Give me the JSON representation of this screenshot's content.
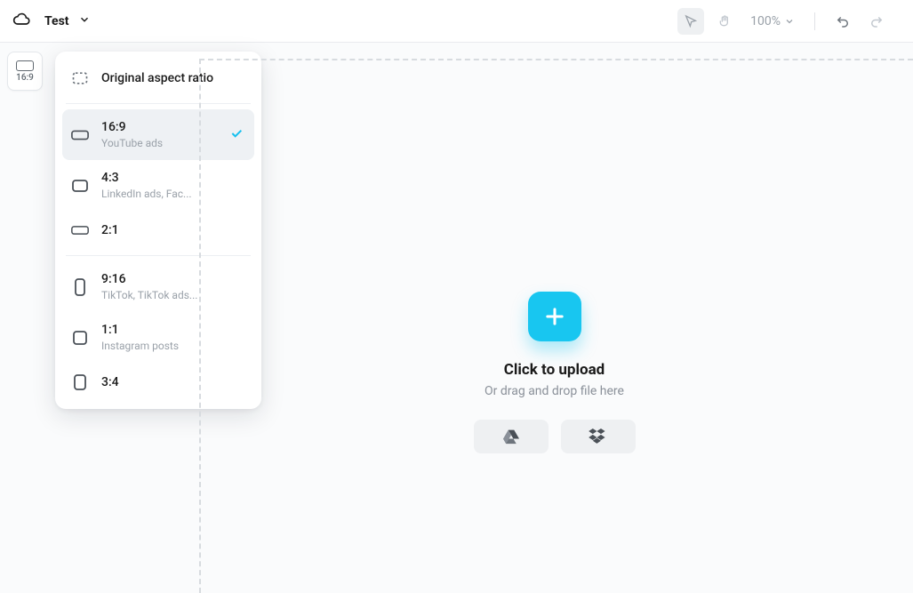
{
  "header": {
    "project": "Test",
    "zoom": "100%"
  },
  "aspect_badge": {
    "label": "16:9"
  },
  "ratio_panel": {
    "original_label": "Original aspect ratio",
    "items": [
      {
        "label": "16:9",
        "sub": "YouTube ads",
        "selected": true,
        "icon": "wide"
      },
      {
        "label": "4:3",
        "sub": "LinkedIn ads, Fac...",
        "selected": false,
        "icon": "4x3"
      },
      {
        "label": "2:1",
        "sub": "",
        "selected": false,
        "icon": "wide2"
      }
    ],
    "items_vertical": [
      {
        "label": "9:16",
        "sub": "TikTok, TikTok ads...",
        "selected": false,
        "icon": "tall"
      },
      {
        "label": "1:1",
        "sub": "Instagram posts",
        "selected": false,
        "icon": "square"
      },
      {
        "label": "3:4",
        "sub": "",
        "selected": false,
        "icon": "3x4"
      }
    ]
  },
  "upload": {
    "title": "Click to upload",
    "sub": "Or drag and drop file here"
  }
}
